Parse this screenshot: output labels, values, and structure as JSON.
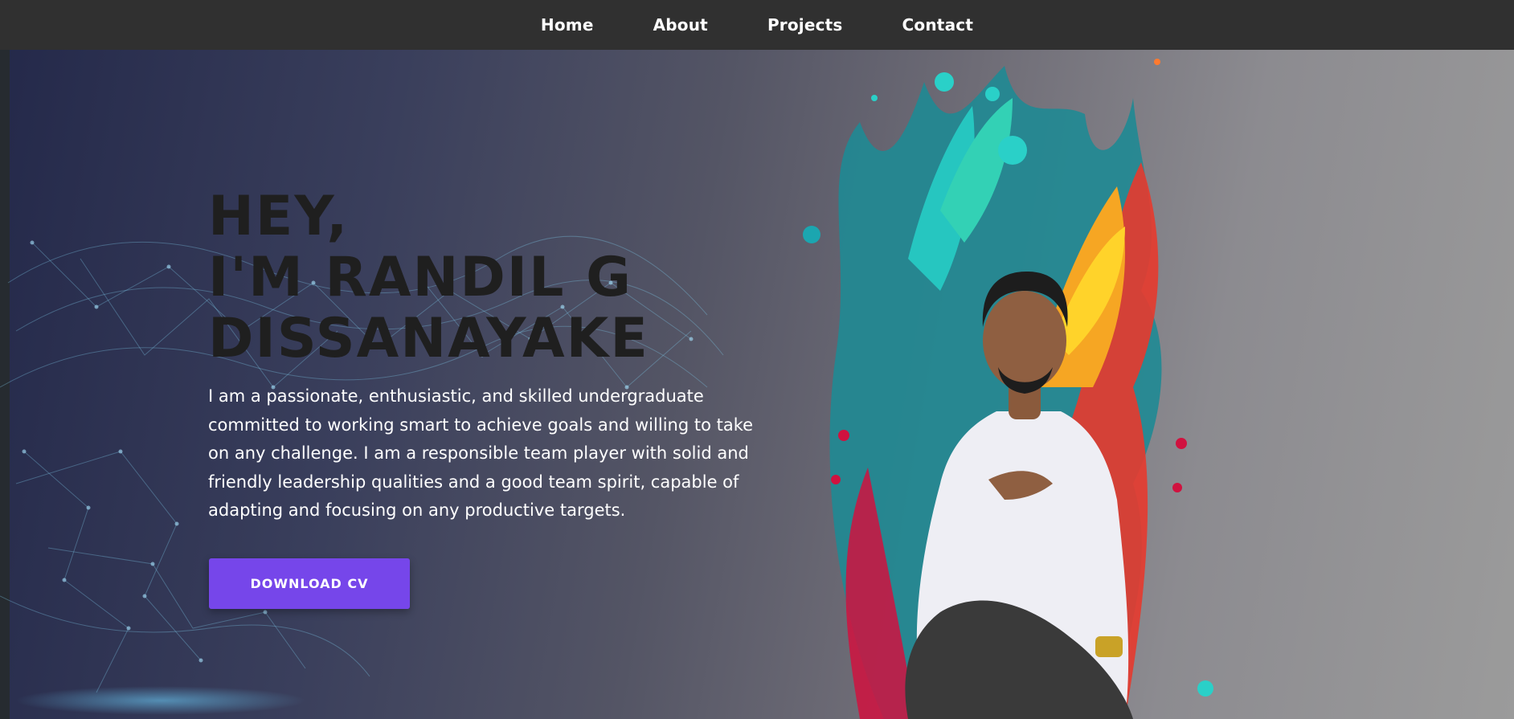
{
  "nav": {
    "items": [
      {
        "label": "Home"
      },
      {
        "label": "About"
      },
      {
        "label": "Projects"
      },
      {
        "label": "Contact"
      }
    ]
  },
  "hero": {
    "title_line1": "HEY,",
    "title_line2": "I'M RANDIL G",
    "title_line3": "DISSANAYAKE",
    "description": "I am a passionate, enthusiastic, and skilled undergraduate committed to working smart to achieve goals and willing to take on any challenge. I am a responsible team player with solid and friendly leadership qualities and a good team spirit, capable of adapting and focusing on any productive targets.",
    "button_label": "DOWNLOAD CV"
  },
  "colors": {
    "accent": "#7646ea",
    "navbar": "#303030",
    "title": "#1f1f1f"
  },
  "images": {
    "background": "network-mesh-illustration",
    "portrait": "person-with-paint-splash"
  }
}
